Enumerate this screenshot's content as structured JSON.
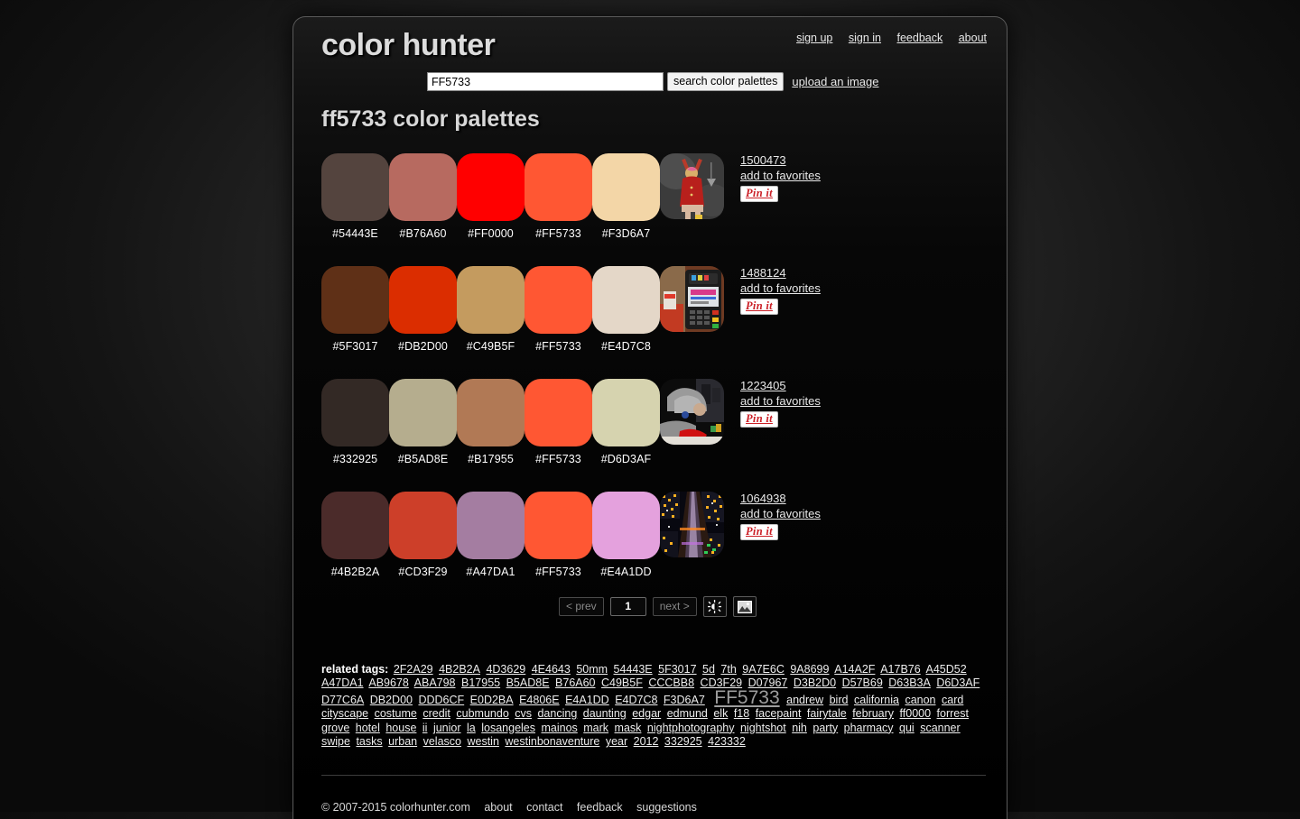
{
  "site": {
    "logo": "color hunter",
    "page_title": "ff5733 color palettes"
  },
  "topnav": [
    {
      "label": "sign up",
      "name": "sign-up"
    },
    {
      "label": "sign in",
      "name": "sign-in"
    },
    {
      "label": "feedback",
      "name": "feedback"
    },
    {
      "label": "about",
      "name": "about"
    }
  ],
  "search": {
    "value": "FF5733",
    "placeholder": "",
    "button_label": "search color palettes",
    "upload_label": "upload an image"
  },
  "palettes": [
    {
      "id": "1500473",
      "fav_label": "add to favorites",
      "pin_label": "Pin it",
      "colors": [
        "#54443E",
        "#B76A60",
        "#FF0000",
        "#FF5733",
        "#F3D6A7"
      ],
      "thumb": "woman-in-red-coat-arms-raised"
    },
    {
      "id": "1488124",
      "fav_label": "add to favorites",
      "pin_label": "Pin it",
      "colors": [
        "#5F3017",
        "#DB2D00",
        "#C49B5F",
        "#FF5733",
        "#E4D7C8"
      ],
      "thumb": "card-payment-terminal"
    },
    {
      "id": "1223405",
      "fav_label": "add to favorites",
      "pin_label": "Pin it",
      "colors": [
        "#332925",
        "#B5AD8E",
        "#B17955",
        "#FF5733",
        "#D6D3AF"
      ],
      "thumb": "person-in-grey-hoodie-at-desk"
    },
    {
      "id": "1064938",
      "fav_label": "add to favorites",
      "pin_label": "Pin it",
      "colors": [
        "#4B2B2A",
        "#CD3F29",
        "#A47DA1",
        "#FF5733",
        "#E4A1DD"
      ],
      "thumb": "city-street-at-night-aerial"
    }
  ],
  "pagination": {
    "prev_label": "< prev",
    "current_page": "1",
    "next_label": "next >",
    "brightness_icon": "sun-icon",
    "image_icon": "picture-icon"
  },
  "related_tags": {
    "label": "related tags:",
    "current": "FF5733",
    "tags": [
      "2F2A29",
      "4B2B2A",
      "4D3629",
      "4E4643",
      "50mm",
      "54443E",
      "5F3017",
      "5d",
      "7th",
      "9A7E6C",
      "9A8699",
      "A14A2F",
      "A17B76",
      "A45D52",
      "A47DA1",
      "AB9678",
      "ABA798",
      "B17955",
      "B5AD8E",
      "B76A60",
      "C49B5F",
      "CCCBB8",
      "CD3F29",
      "D07967",
      "D3B2D0",
      "D57B69",
      "D63B3A",
      "D6D3AF",
      "D77C6A",
      "DB2D00",
      "DDD6CF",
      "E0D2BA",
      "E4806E",
      "E4A1DD",
      "E4D7C8",
      "F3D6A7",
      "FF5733",
      "andrew",
      "bird",
      "california",
      "canon",
      "card",
      "cityscape",
      "costume",
      "credit",
      "cubmundo",
      "cvs",
      "dancing",
      "daunting",
      "edgar",
      "edmund",
      "elk",
      "f18",
      "facepaint",
      "fairytale",
      "february",
      "ff0000",
      "forrest",
      "grove",
      "hotel",
      "house",
      "ii",
      "junior",
      "la",
      "losangeles",
      "mainos",
      "mark",
      "mask",
      "nightphotography",
      "nightshot",
      "nih",
      "party",
      "pharmacy",
      "qui",
      "scanner",
      "swipe",
      "tasks",
      "urban",
      "velasco",
      "westin",
      "westinbonaventure",
      "year",
      "2012",
      "332925",
      "423332"
    ]
  },
  "footer": {
    "copyright": "© 2007-2015 colorhunter.com",
    "links": [
      "about",
      "contact",
      "feedback",
      "suggestions"
    ]
  }
}
